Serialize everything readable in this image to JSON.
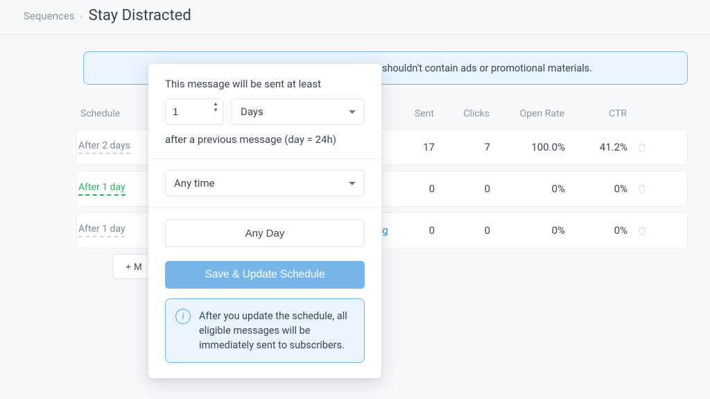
{
  "breadcrumb": {
    "parent": "Sequences",
    "title": "Stay Distracted"
  },
  "alert_top": "shouldn't contain ads or promotional materials.",
  "table": {
    "headers": {
      "schedule": "Schedule",
      "sent": "Sent",
      "clicks": "Clicks",
      "open_rate": "Open Rate",
      "ctr": "CTR"
    },
    "rows": [
      {
        "schedule": "After 2 days",
        "active": false,
        "sent": "17",
        "clicks": "7",
        "open_rate": "100.0%",
        "ctr": "41.2%",
        "message": ""
      },
      {
        "schedule": "After 1 day",
        "active": true,
        "sent": "0",
        "clicks": "0",
        "open_rate": "0%",
        "ctr": "0%",
        "message": ""
      },
      {
        "schedule": "After 1 day",
        "active": false,
        "sent": "0",
        "clicks": "0",
        "open_rate": "0%",
        "ctr": "0%",
        "message": "ng"
      }
    ]
  },
  "add_button": "+ M",
  "popover": {
    "heading": "This message will be sent at least",
    "number_value": "1",
    "unit_selected": "Days",
    "subtext": "after a previous message (day = 24h)",
    "time_selected": "Any time",
    "any_day_label": "Any Day",
    "save_label": "Save & Update Schedule",
    "info_text": "After you update the schedule, all eligible messages will be immediately sent to subscribers."
  }
}
